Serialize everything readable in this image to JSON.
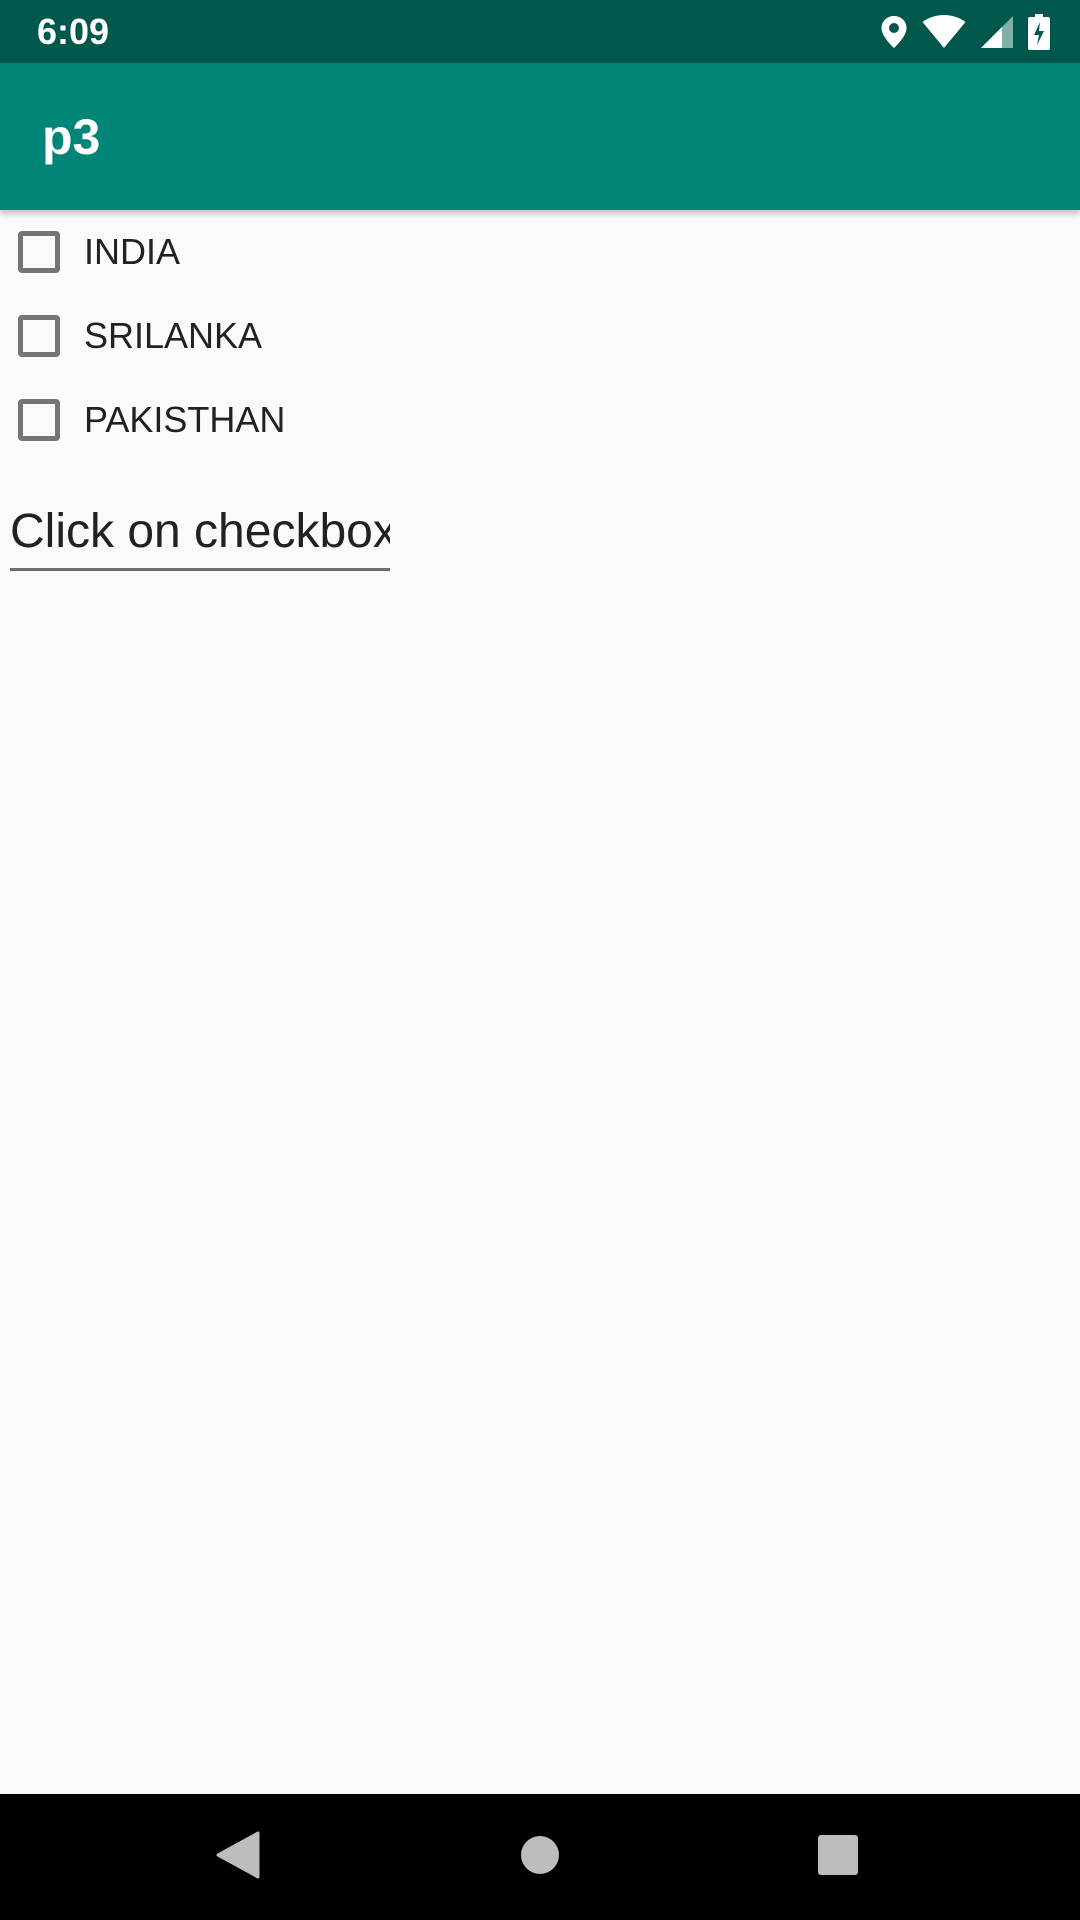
{
  "status_bar": {
    "time": "6:09",
    "icons": [
      "location-icon",
      "wifi-icon",
      "signal-icon",
      "battery-charging-icon"
    ]
  },
  "app_bar": {
    "title": "p3",
    "color": "#008577"
  },
  "checkboxes": [
    {
      "label": "INDIA",
      "checked": false
    },
    {
      "label": "SRILANKA",
      "checked": false
    },
    {
      "label": "PAKISTHAN",
      "checked": false
    }
  ],
  "result_field": {
    "value": "Click on checkbox"
  },
  "nav_bar": {
    "buttons": [
      "back-icon",
      "home-icon",
      "recents-icon"
    ]
  },
  "colors": {
    "status_bar": "#00574b",
    "app_bar": "#008577",
    "background": "#fafafa"
  }
}
